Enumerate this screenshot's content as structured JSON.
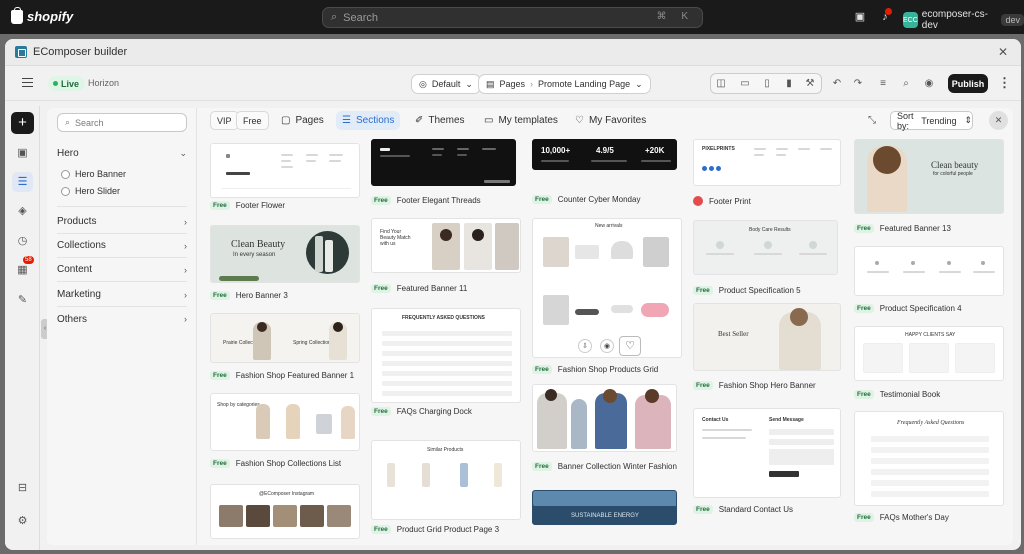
{
  "shopify": {
    "logo_text": "shopify",
    "search_placeholder": "Search",
    "search_shortcut": "⌘ K",
    "account_initials": "ECC",
    "account_name": "ecomposer-cs-dev",
    "account_tag": "dev"
  },
  "modal": {
    "title": "EComposer builder",
    "toolbar": {
      "status": "Live",
      "theme_name": "Horizon",
      "layout_select": "Default",
      "pages_label": "Pages",
      "page_name": "Promote Landing Page",
      "publish_label": "Publish"
    },
    "rail_badge": "58"
  },
  "library": {
    "search_placeholder": "Search",
    "categories": [
      {
        "label": "Hero",
        "expanded": true,
        "children": [
          "Hero Banner",
          "Hero Slider"
        ]
      },
      {
        "label": "Products"
      },
      {
        "label": "Collections"
      },
      {
        "label": "Content"
      },
      {
        "label": "Marketing"
      },
      {
        "label": "Others"
      }
    ],
    "tabs": {
      "vip": "VIP",
      "free": "Free",
      "pages": "Pages",
      "sections": "Sections",
      "themes": "Themes",
      "my_templates": "My templates",
      "my_favorites": "My Favorites"
    },
    "sort_label": "Sort by:",
    "sort_value": "Trending",
    "free_tag": "Free",
    "cards": {
      "col1": [
        "Footer Flower",
        "Hero Banner 3",
        "Fashion Shop Featured Banner 1",
        "Fashion Shop Collections List",
        ""
      ],
      "col2": [
        "Footer Elegant Threads",
        "Featured Banner 11",
        "FAQs Charging Dock",
        "Product Grid Product Page 3"
      ],
      "col3": [
        "Counter Cyber Monday",
        "Fashion Shop Products Grid",
        "Banner Collection Winter Fashion",
        ""
      ],
      "col4": [
        "Footer Print",
        "Product Specification 5",
        "Fashion Shop Hero Banner",
        "Standard Contact Us"
      ],
      "col5": [
        "Featured Banner 13",
        "Product Specification 4",
        "Testimonial Book",
        "FAQs Mother's Day"
      ]
    },
    "thumb_text": {
      "clean_beauty": "Clean Beauty",
      "clean_beauty_sub": "In every season",
      "clean_beauty2": "Clean beauty",
      "clean_beauty2_sub": "for colorful people",
      "find_beauty": "Find Your Beauty Match with us",
      "faq_title": "FREQUENTLY ASKED QUESTIONS",
      "similar": "Similar Products",
      "stat1": "10,000+",
      "stat2": "4.9/5",
      "stat3": "+20K",
      "new_arrivals": "New arrivals",
      "prairie": "Prairie Collection",
      "spring": "Spring Collection",
      "shop_by": "Shop by categories",
      "body_care": "Body Care Results",
      "best_seller": "Best Seller",
      "contact_us": "Contact Us",
      "send_message": "Send Message",
      "happy": "HAPPY CLIENTS SAY",
      "faq2": "Frequently Asked Questions",
      "ec_insta": "@EComposer Instagram",
      "sustainable": "SUSTAINABLE ENERGY",
      "pixelprints": "PIXELPRINTS"
    }
  },
  "colors": {
    "accent_blue": "#2c6ecb",
    "live_green": "#2bb35a",
    "publish_black": "#1a1a1a",
    "badge_red": "#e51c00"
  }
}
